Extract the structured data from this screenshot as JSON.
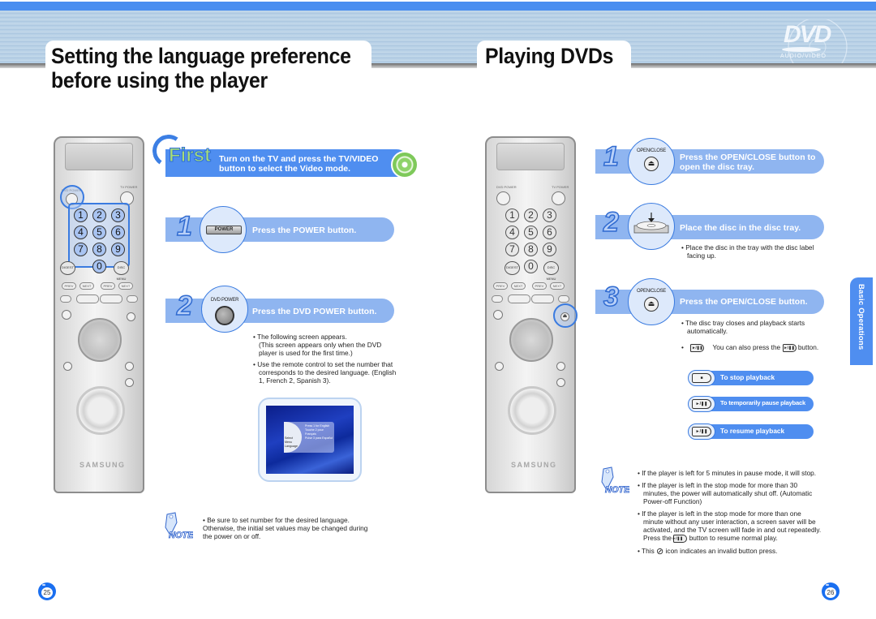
{
  "header": {
    "left_title_line1": "Setting the language preference",
    "left_title_line2": "before using the player",
    "right_title": "Playing DVDs",
    "logo_word": "DVD",
    "logo_sub": "AUDIO/VIDEO"
  },
  "remote": {
    "dvd_power_label": "DVD POWER",
    "tv_power_label": "TV POWER",
    "digits": [
      "1",
      "2",
      "3",
      "4",
      "5",
      "6",
      "7",
      "8",
      "9",
      "0"
    ],
    "disc_menu_label": "DISC MENU",
    "digits_label": "DIGEST",
    "left_pills": [
      "PREV",
      "NEXT",
      "PREV",
      "NEXT"
    ],
    "brand": "SAMSUNG"
  },
  "left_page": {
    "first_label": "First",
    "first_text_line1": "Turn on the TV and press the TV/VIDEO",
    "first_text_line2": "button to select the Video mode.",
    "step1": {
      "num": "1",
      "button_label": "POWER",
      "text": "Press the POWER button."
    },
    "step2": {
      "num": "2",
      "button_caption": "DVD POWER",
      "text": "Press the DVD POWER button.",
      "bullets": [
        "• The following screen appears.",
        "(This screen appears only when the DVD player is used for the first time.)",
        "• Use the remote control to set the number that corresponds to the desired language. (English 1, French 2, Spanish 3)."
      ]
    },
    "tv_screen": {
      "lines": [
        "Press 1 for English",
        "Touche 2 pour Français",
        "Pulse 3 para Español"
      ],
      "left_lines": [
        "Select",
        "Menu",
        "Language"
      ]
    },
    "note": "• Be sure to set number for the desired language. Otherwise, the initial set values may be changed during the power on or off.",
    "page_number": "25"
  },
  "right_page": {
    "step1": {
      "num": "1",
      "button_caption": "OPEN/CLOSE",
      "text_line1": "Press the OPEN/CLOSE button to",
      "text_line2": "open the disc tray."
    },
    "step2": {
      "num": "2",
      "text": "Place the disc in the disc tray.",
      "bullet": "• Place the disc in the tray with the disc label facing up."
    },
    "step3": {
      "num": "3",
      "button_caption": "OPEN/CLOSE",
      "text": "Press the OPEN/CLOSE button.",
      "bullet1": "• The disc tray closes and playback starts automatically.",
      "bullet2_prefix": "•",
      "bullet2_text": "You can also press the",
      "bullet2_suffix": "button."
    },
    "playback": [
      {
        "icon": "stop-icon",
        "glyph": "■",
        "label": "To stop playback"
      },
      {
        "icon": "play-pause-icon",
        "glyph": "►/❚❚",
        "label": "To temporarily pause playback"
      },
      {
        "icon": "play-pause-icon",
        "glyph": "►/❚❚",
        "label": "To resume playback"
      }
    ],
    "notes": [
      "• If the player is left for 5 minutes in pause mode, it will stop.",
      "• If the player is left in the stop mode for more than 30 minutes, the power will automatically shut off. (Automatic Power-off Function)",
      "• If the player is left in the stop mode for more than one minute without any user interaction, a screen saver will be activated, and the TV screen will fade in and out repeatedly. Press the",
      "button to resume normal play.",
      "• This",
      "icon indicates an invalid button press."
    ],
    "side_tab": "Basic Operations",
    "page_number": "26"
  },
  "colors": {
    "accent_blue": "#4f8ef0",
    "light_blue": "#8fb5f0",
    "page_num_blue": "#1a6ff0"
  }
}
